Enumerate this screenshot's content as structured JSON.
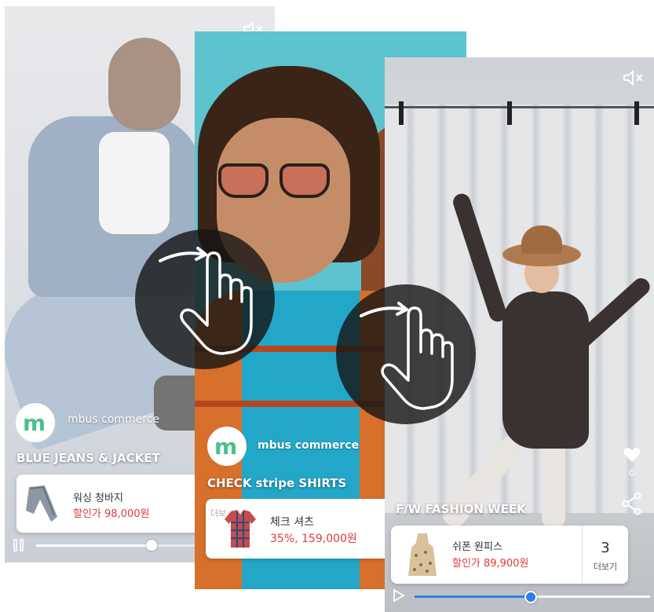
{
  "brand": {
    "name": "mbus commerce",
    "logo_letter": "m"
  },
  "cards": [
    {
      "title": "BLUE JEANS & JACKET",
      "product": {
        "name": "워싱 청바지",
        "price": "할인가 98,000원"
      },
      "progress": 0.64
    },
    {
      "title": "CHECK stripe SHIRTS",
      "product": {
        "name": "체크 셔츠",
        "price": "35%, 159,000원",
        "more_label": "더보"
      }
    },
    {
      "title": "F/W FASHION WEEK",
      "product": {
        "name": "쉬폰 원피스",
        "price": "할인가 89,900원"
      },
      "more": {
        "count": "3",
        "label": "더보기"
      },
      "likes": "0",
      "progress": 0.49
    }
  ],
  "icons": {
    "mute": "speaker-mute-icon",
    "pause": "pause-icon",
    "play": "play-icon",
    "heart": "heart-icon",
    "share": "share-icon",
    "swipe": "swipe-hand-icon"
  },
  "colors": {
    "price_red": "#e0393b",
    "brand_green": "#4bbf8c",
    "gesture_bg": "#141414"
  }
}
